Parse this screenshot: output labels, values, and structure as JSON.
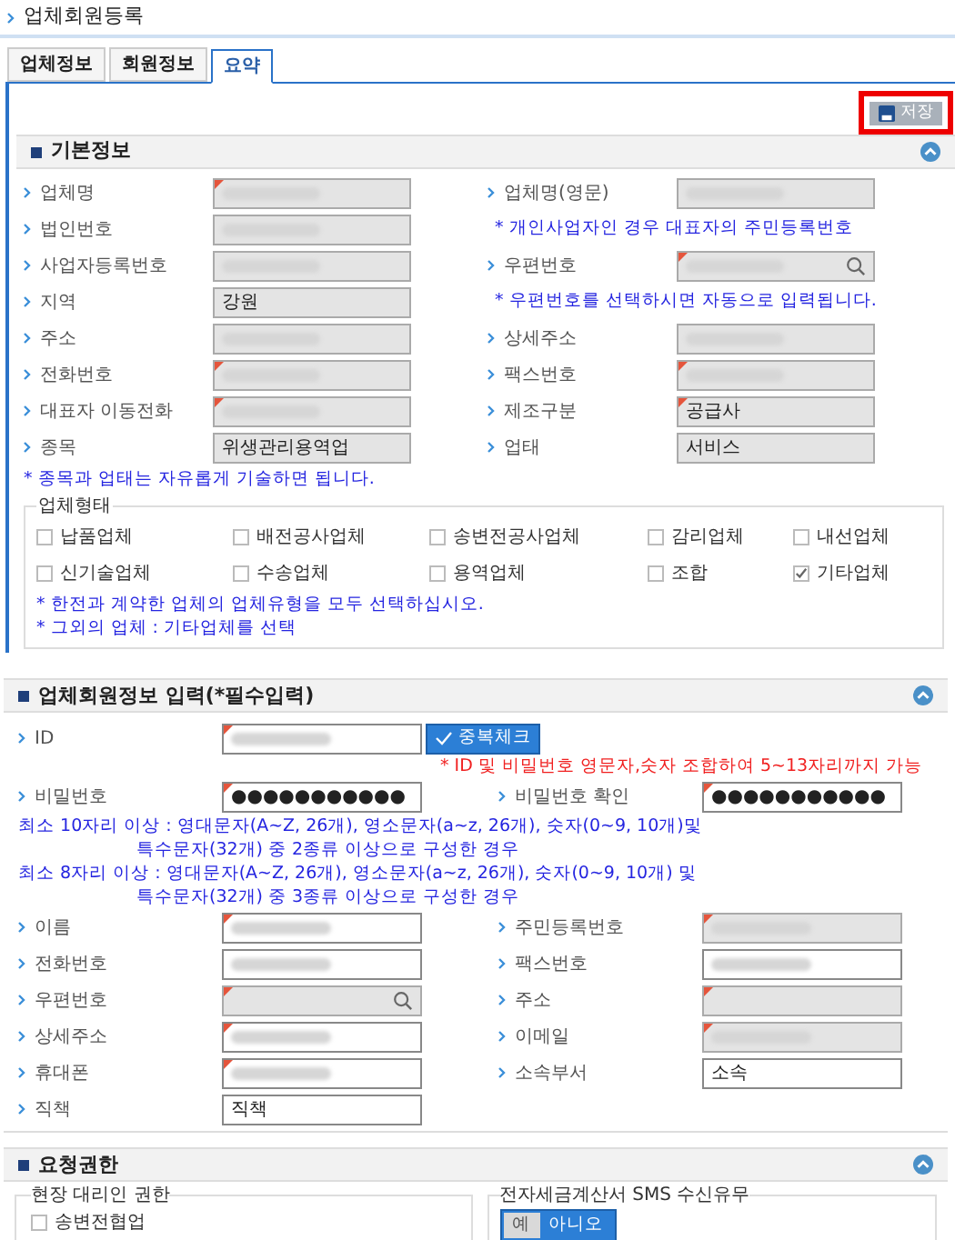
{
  "page_title": "업체회원등록",
  "tabs": [
    {
      "label": "업체정보",
      "selected": false
    },
    {
      "label": "회원정보",
      "selected": false
    },
    {
      "label": "요약",
      "selected": true
    }
  ],
  "save_button": {
    "label": "저장",
    "highlighted": true
  },
  "basic_info": {
    "title": "기본정보",
    "expanded": true,
    "rows": [
      {
        "cells": [
          {
            "kind": "field",
            "label": "업체명",
            "blurred": true,
            "readonly": true,
            "required": true
          },
          {
            "kind": "field",
            "label": "업체명(영문)",
            "blurred": true,
            "readonly": true,
            "required": false
          }
        ]
      },
      {
        "cells": [
          {
            "kind": "field",
            "label": "법인번호",
            "blurred": true,
            "readonly": true,
            "required": false
          },
          {
            "kind": "note",
            "text": "* 개인사업자인 경우 대표자의 주민등록번호"
          }
        ]
      },
      {
        "cells": [
          {
            "kind": "field",
            "label": "사업자등록번호",
            "blurred": true,
            "readonly": true,
            "required": false
          },
          {
            "kind": "field",
            "label": "우편번호",
            "blurred": true,
            "readonly": true,
            "required": true,
            "search": true
          }
        ]
      },
      {
        "cells": [
          {
            "kind": "field",
            "label": "지역",
            "value": "강원",
            "readonly": true,
            "required": false
          },
          {
            "kind": "note",
            "text": "* 우편번호를 선택하시면 자동으로 입력됩니다."
          }
        ]
      },
      {
        "cells": [
          {
            "kind": "field",
            "label": "주소",
            "blurred": true,
            "readonly": true,
            "required": false
          },
          {
            "kind": "field",
            "label": "상세주소",
            "blurred": true,
            "readonly": true,
            "required": false
          }
        ]
      },
      {
        "cells": [
          {
            "kind": "field",
            "label": "전화번호",
            "blurred": true,
            "readonly": true,
            "required": true
          },
          {
            "kind": "field",
            "label": "팩스번호",
            "blurred": true,
            "readonly": true,
            "required": true
          }
        ]
      },
      {
        "cells": [
          {
            "kind": "field",
            "label": "대표자 이동전화",
            "blurred": true,
            "readonly": true,
            "required": true
          },
          {
            "kind": "field",
            "label": "제조구분",
            "value": "공급사",
            "readonly": true,
            "required": true
          }
        ]
      },
      {
        "cells": [
          {
            "kind": "field",
            "label": "종목",
            "value": "위생관리용역업",
            "readonly": true,
            "required": false
          },
          {
            "kind": "field",
            "label": "업태",
            "value": "서비스",
            "readonly": true,
            "required": false
          }
        ]
      }
    ],
    "note": "* 종목과 업태는 자유롭게 기술하면 됩니다.",
    "company_type": {
      "legend": "업체형태",
      "options": [
        {
          "label": "납품업체",
          "checked": false
        },
        {
          "label": "배전공사업체",
          "checked": false
        },
        {
          "label": "송변전공사업체",
          "checked": false
        },
        {
          "label": "감리업체",
          "checked": false
        },
        {
          "label": "내선업체",
          "checked": false
        },
        {
          "label": "신기술업체",
          "checked": false
        },
        {
          "label": "수송업체",
          "checked": false
        },
        {
          "label": "용역업체",
          "checked": false
        },
        {
          "label": "조합",
          "checked": false
        },
        {
          "label": "기타업체",
          "checked": true
        }
      ],
      "notes": [
        "* 한전과 계약한 업체의 업체유형을 모두 선택하십시오.",
        "* 그외의 업체 : 기타업체를 선택"
      ]
    }
  },
  "member_info": {
    "title": "업체회원정보 입력(*필수입력)",
    "expanded": true,
    "id_field": {
      "label": "ID",
      "blurred": true,
      "readonly": false,
      "required": true
    },
    "check_button": "중복체크",
    "id_note": "* ID 및 비밀번호 영문자,숫자 조합하여 5~13자리까지 가능",
    "password_row": {
      "cells": [
        {
          "kind": "field",
          "label": "비밀번호",
          "value": "●●●●●●●●●●●",
          "readonly": false,
          "required": true
        },
        {
          "kind": "field",
          "label": "비밀번호 확인",
          "value": "●●●●●●●●●●●",
          "readonly": false,
          "required": true
        }
      ]
    },
    "password_rules": [
      {
        "lead": "최소 10자리 이상 : 영대문자(A~Z, 26개), 영소문자(a~z, 26개), 숫자(0~9, 10개)및",
        "cont": "특수문자(32개) 중 2종류 이상으로 구성한 경우"
      },
      {
        "lead": "최소 8자리 이상 : 영대문자(A~Z, 26개), 영소문자(a~z, 26개), 숫자(0~9, 10개) 및",
        "cont": "특수문자(32개) 중 3종류 이상으로 구성한 경우"
      }
    ],
    "rows": [
      {
        "cells": [
          {
            "kind": "field",
            "label": "이름",
            "blurred": true,
            "readonly": false,
            "required": true
          },
          {
            "kind": "field",
            "label": "주민등록번호",
            "blurred": true,
            "readonly": true,
            "required": true
          }
        ]
      },
      {
        "cells": [
          {
            "kind": "field",
            "label": "전화번호",
            "blurred": true,
            "readonly": false,
            "required": false
          },
          {
            "kind": "field",
            "label": "팩스번호",
            "blurred": true,
            "readonly": false,
            "required": false
          }
        ]
      },
      {
        "cells": [
          {
            "kind": "field",
            "label": "우편번호",
            "readonly": true,
            "required": true,
            "search": true
          },
          {
            "kind": "field",
            "label": "주소",
            "readonly": true,
            "required": true
          }
        ]
      },
      {
        "cells": [
          {
            "kind": "field",
            "label": "상세주소",
            "blurred": true,
            "readonly": false,
            "required": true
          },
          {
            "kind": "field",
            "label": "이메일",
            "blurred": true,
            "readonly": true,
            "required": true
          }
        ]
      },
      {
        "cells": [
          {
            "kind": "field",
            "label": "휴대폰",
            "blurred": true,
            "readonly": false,
            "required": true
          },
          {
            "kind": "field",
            "label": "소속부서",
            "value": "소속",
            "readonly": false,
            "required": false
          }
        ]
      },
      {
        "cells": [
          {
            "kind": "field",
            "label": "직책",
            "value": "직책",
            "readonly": false,
            "required": false
          }
        ]
      }
    ]
  },
  "permissions": {
    "title": "요청권한",
    "expanded": true,
    "agent": {
      "legend": "현장 대리인 권한",
      "options": [
        {
          "label": "송변전협업",
          "checked": false
        }
      ]
    },
    "sms": {
      "legend": "전자세금계산서 SMS 수신유무",
      "options": [
        {
          "label": "예",
          "selected": false
        },
        {
          "label": "아니오",
          "selected": true
        }
      ]
    }
  }
}
